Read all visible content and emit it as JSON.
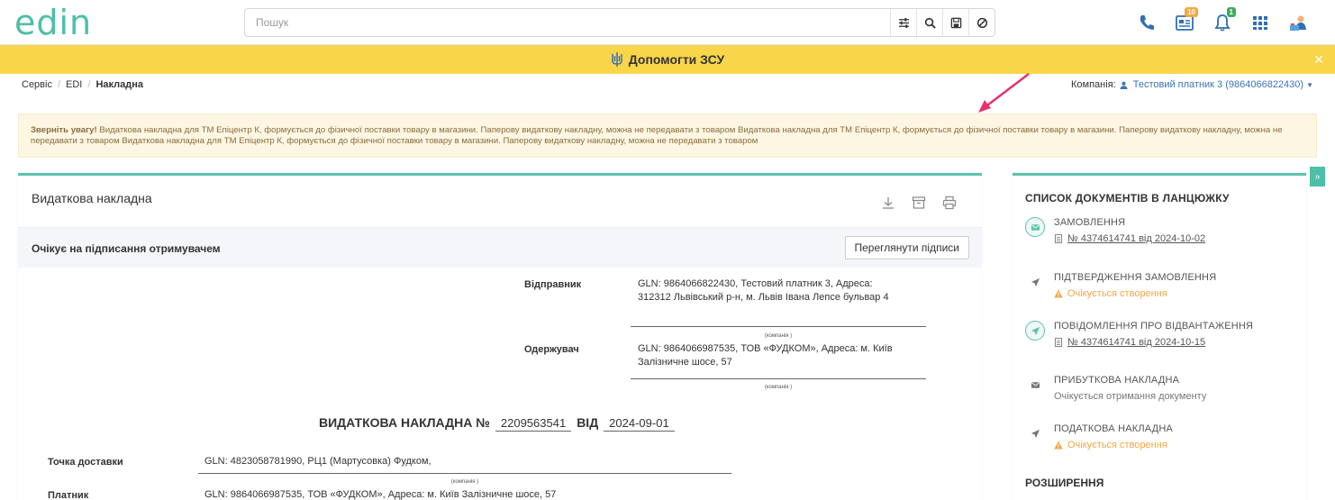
{
  "header": {
    "logo": "edin",
    "search_placeholder": "Пошук",
    "notifications": {
      "docs_count": "10",
      "bell_count": "1"
    }
  },
  "banner": {
    "text": "Допомогти ЗСУ"
  },
  "breadcrumb": {
    "items": [
      "Сервіс",
      "EDI",
      "Накладна"
    ]
  },
  "company": {
    "label": "Компанія:",
    "name": "Тестовий платник 3 (9864066822430)"
  },
  "warning": {
    "bold": "Зверніть увагу!",
    "text": " Видаткова накладна для ТМ Епіцентр К, формується до фізичної поставки товару в магазини. Паперову видаткову накладну, можна не передавати з товаром Видаткова накладна для ТМ Епіцентр К, формується до фізичної поставки товару в магазини. Паперову видаткову накладну, можна не передавати з товаром Видаткова накладна для ТМ Епіцентр К, формується до фізичної поставки товару в магазини. Паперову видаткову накладну, можна не передавати з товаром"
  },
  "document": {
    "title": "Видаткова накладна",
    "status": "Очікує на підписання отримувачем",
    "view_signatures": "Переглянути підписи",
    "sender_label": "Відправник",
    "sender_value": "GLN: 9864066822430, Тестовий платник 3, Адреса: 312312 Львівський р-н, м. Львів Івана Лепсе бульвар 4",
    "company_caption": "(компанія )",
    "receiver_label": "Одержувач",
    "receiver_value": "GLN: 9864066987535, ТОВ «ФУДКОМ», Адреса: м. Київ Залізничне шосе, 57",
    "heading": "ВИДАТКОВА НАКЛАДНА №",
    "number": "2209563541",
    "date_label": "ВІД",
    "date": "2024-09-01",
    "delivery_label": "Точка доставки",
    "delivery_value": "GLN: 4823058781990, РЦ1 (Мартусовка) Фудком,",
    "payer_label": "Платник",
    "payer_value": "GLN: 9864066987535, ТОВ «ФУДКОМ», Адреса: м. Київ Залізничне шосе, 57"
  },
  "chain": {
    "title": "СПИСОК ДОКУМЕНТІВ В ЛАНЦЮЖКУ",
    "items": [
      {
        "name": "ЗАМОВЛЕННЯ",
        "sub": "№ 4374614741 від 2024-10-02"
      },
      {
        "name": "ПІДТВЕРДЖЕННЯ ЗАМОВЛЕННЯ",
        "sub": "Очікується створення"
      },
      {
        "name": "ПОВІДОМЛЕННЯ ПРО ВІДВАНТАЖЕННЯ",
        "sub": "№ 4374614741 від 2024-10-15"
      },
      {
        "name": "ПРИБУТКОВА НАКЛАДНА",
        "sub": "Очікується отримання документу"
      },
      {
        "name": "ПОДАТКОВА НАКЛАДНА",
        "sub": "Очікується створення"
      }
    ],
    "extensions_title": "РОЗШИРЕННЯ"
  },
  "colors": {
    "accent": "#5dc2ad",
    "banner": "#f9d54a",
    "warning_bg": "#fcf6e3",
    "link": "#3b73b9",
    "pending": "#f4a742"
  }
}
